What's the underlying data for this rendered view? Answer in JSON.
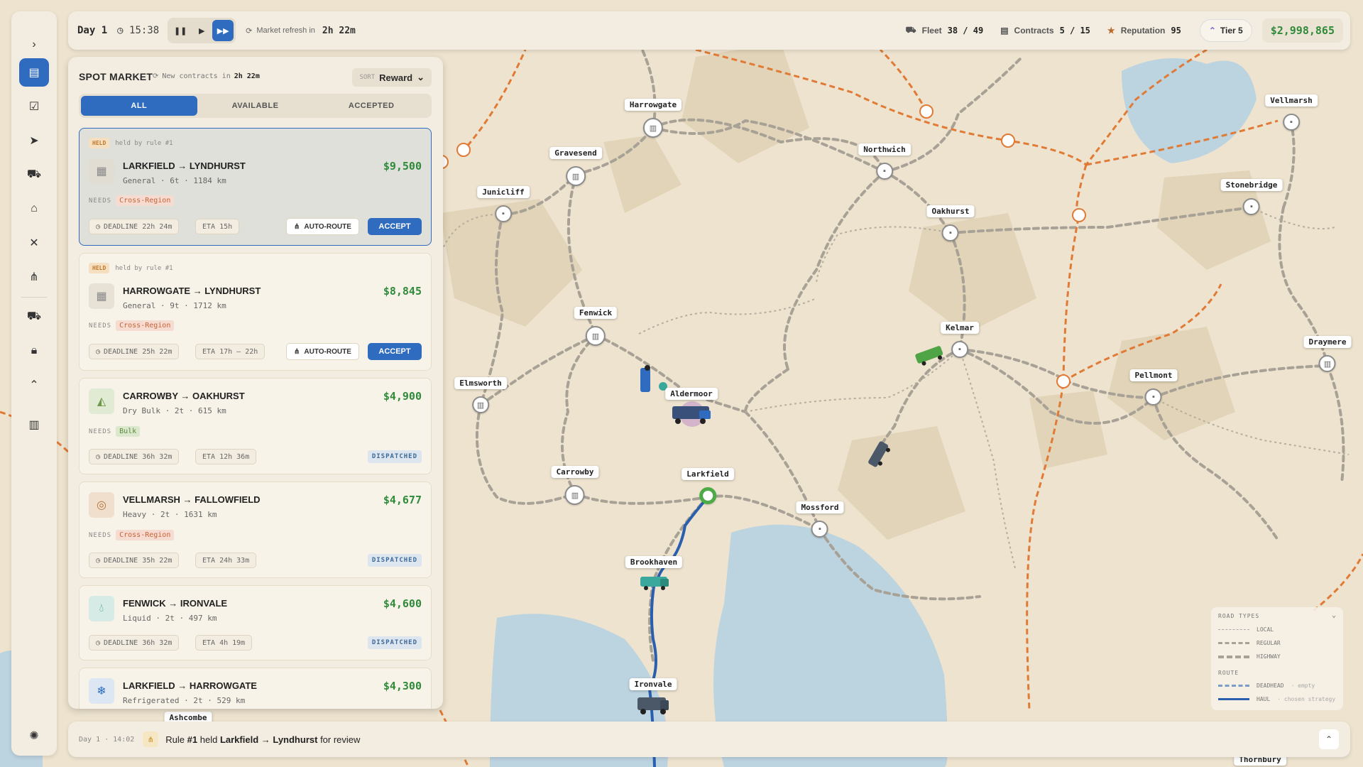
{
  "topbar": {
    "day": "Day 1",
    "time": "15:38",
    "refresh_label": "Market refresh in",
    "refresh_value": "2h 22m",
    "fleet_label": "Fleet",
    "fleet_value": "38 / 49",
    "contracts_label": "Contracts",
    "contracts_value": "5 / 15",
    "reputation_label": "Reputation",
    "reputation_value": "95",
    "tier": "Tier 5",
    "money": "$2,998,865"
  },
  "panel": {
    "title": "SPOT MARKET",
    "sub_label": "New contracts in",
    "sub_value": "2h 22m",
    "sort_label": "SORT",
    "sort_value": "Reward",
    "tabs": [
      {
        "label": "ALL",
        "active": true
      },
      {
        "label": "AVAILABLE",
        "active": false
      },
      {
        "label": "ACCEPTED",
        "active": false
      }
    ],
    "cards": [
      {
        "held_tag": "HELD",
        "held_text": "held by rule #1",
        "title": "LARKFIELD → LYNDHURST",
        "sub": "General · 6t · 1184 km",
        "value": "$9,500",
        "needs_label": "NEEDS",
        "needs": "Cross-Region",
        "deadline": "DEADLINE 22h 24m",
        "eta": "ETA 15h",
        "route_btn": "AUTO-ROUTE",
        "accept_btn": "ACCEPT",
        "icon": "crate-icon"
      },
      {
        "held_tag": "HELD",
        "held_text": "held by rule #1",
        "title": "HARROWGATE → LYNDHURST",
        "sub": "General · 9t · 1712 km",
        "value": "$8,845",
        "needs_label": "NEEDS",
        "needs": "Cross-Region",
        "deadline": "DEADLINE 25h 22m",
        "eta": "ETA 17h – 22h",
        "route_btn": "AUTO-ROUTE",
        "accept_btn": "ACCEPT",
        "icon": "crate-icon"
      },
      {
        "title": "CARROWBY → OAKHURST",
        "sub": "Dry Bulk · 2t · 615 km",
        "value": "$4,900",
        "needs_label": "NEEDS",
        "needs": "Bulk",
        "deadline": "DEADLINE 36h 32m",
        "eta": "ETA 12h 36m",
        "status": "DISPATCHED",
        "icon": "bulk-pile-icon"
      },
      {
        "title": "VELLMARSH → FALLOWFIELD",
        "sub": "Heavy · 2t · 1631 km",
        "value": "$4,677",
        "needs_label": "NEEDS",
        "needs": "Cross-Region",
        "deadline": "DEADLINE 35h 22m",
        "eta": "ETA 24h 33m",
        "status": "DISPATCHED",
        "icon": "heavy-coil-icon"
      },
      {
        "title": "FENWICK → IRONVALE",
        "sub": "Liquid · 2t · 497 km",
        "value": "$4,600",
        "deadline": "DEADLINE 36h 32m",
        "eta": "ETA 4h 19m",
        "status": "DISPATCHED",
        "icon": "droplet-icon"
      },
      {
        "title": "LARKFIELD → HARROWGATE",
        "sub": "Refrigerated · 2t · 529 km",
        "value": "$4,300",
        "icon": "snowflake-icon"
      }
    ]
  },
  "cities": [
    {
      "name": "Harrowgate"
    },
    {
      "name": "Gravesend"
    },
    {
      "name": "Junicliff"
    },
    {
      "name": "Northwich"
    },
    {
      "name": "Oakhurst"
    },
    {
      "name": "Vellmarsh"
    },
    {
      "name": "Stonebridge"
    },
    {
      "name": "Fenwick"
    },
    {
      "name": "Kelmar"
    },
    {
      "name": "Draymere"
    },
    {
      "name": "Elmsworth"
    },
    {
      "name": "Aldermoor"
    },
    {
      "name": "Pellmont"
    },
    {
      "name": "Carrowby"
    },
    {
      "name": "Larkfield"
    },
    {
      "name": "Mossford"
    },
    {
      "name": "Brookhaven"
    },
    {
      "name": "Ironvale"
    },
    {
      "name": "Ashcombe"
    },
    {
      "name": "Thornbury"
    }
  ],
  "legend": {
    "title": "ROAD TYPES",
    "local": "LOCAL",
    "regular": "REGULAR",
    "highway": "HIGHWAY",
    "route_title": "ROUTE",
    "deadhead": "DEADHEAD",
    "deadhead_note": "· empty",
    "haul": "HAUL",
    "haul_note": "· chosen strategy"
  },
  "bottombar": {
    "time": "Day 1 · 14:02",
    "msg_prefix": "Rule",
    "msg_rule": "#1",
    "msg_mid": "held",
    "msg_route": "Larkfield → Lyndhurst",
    "msg_suffix": "for review"
  },
  "colors": {
    "accent": "#2f6bbf",
    "money": "#2f8a3a",
    "highway": "#e07a35",
    "water": "#bcd3e0",
    "route": "#2a5fae"
  }
}
